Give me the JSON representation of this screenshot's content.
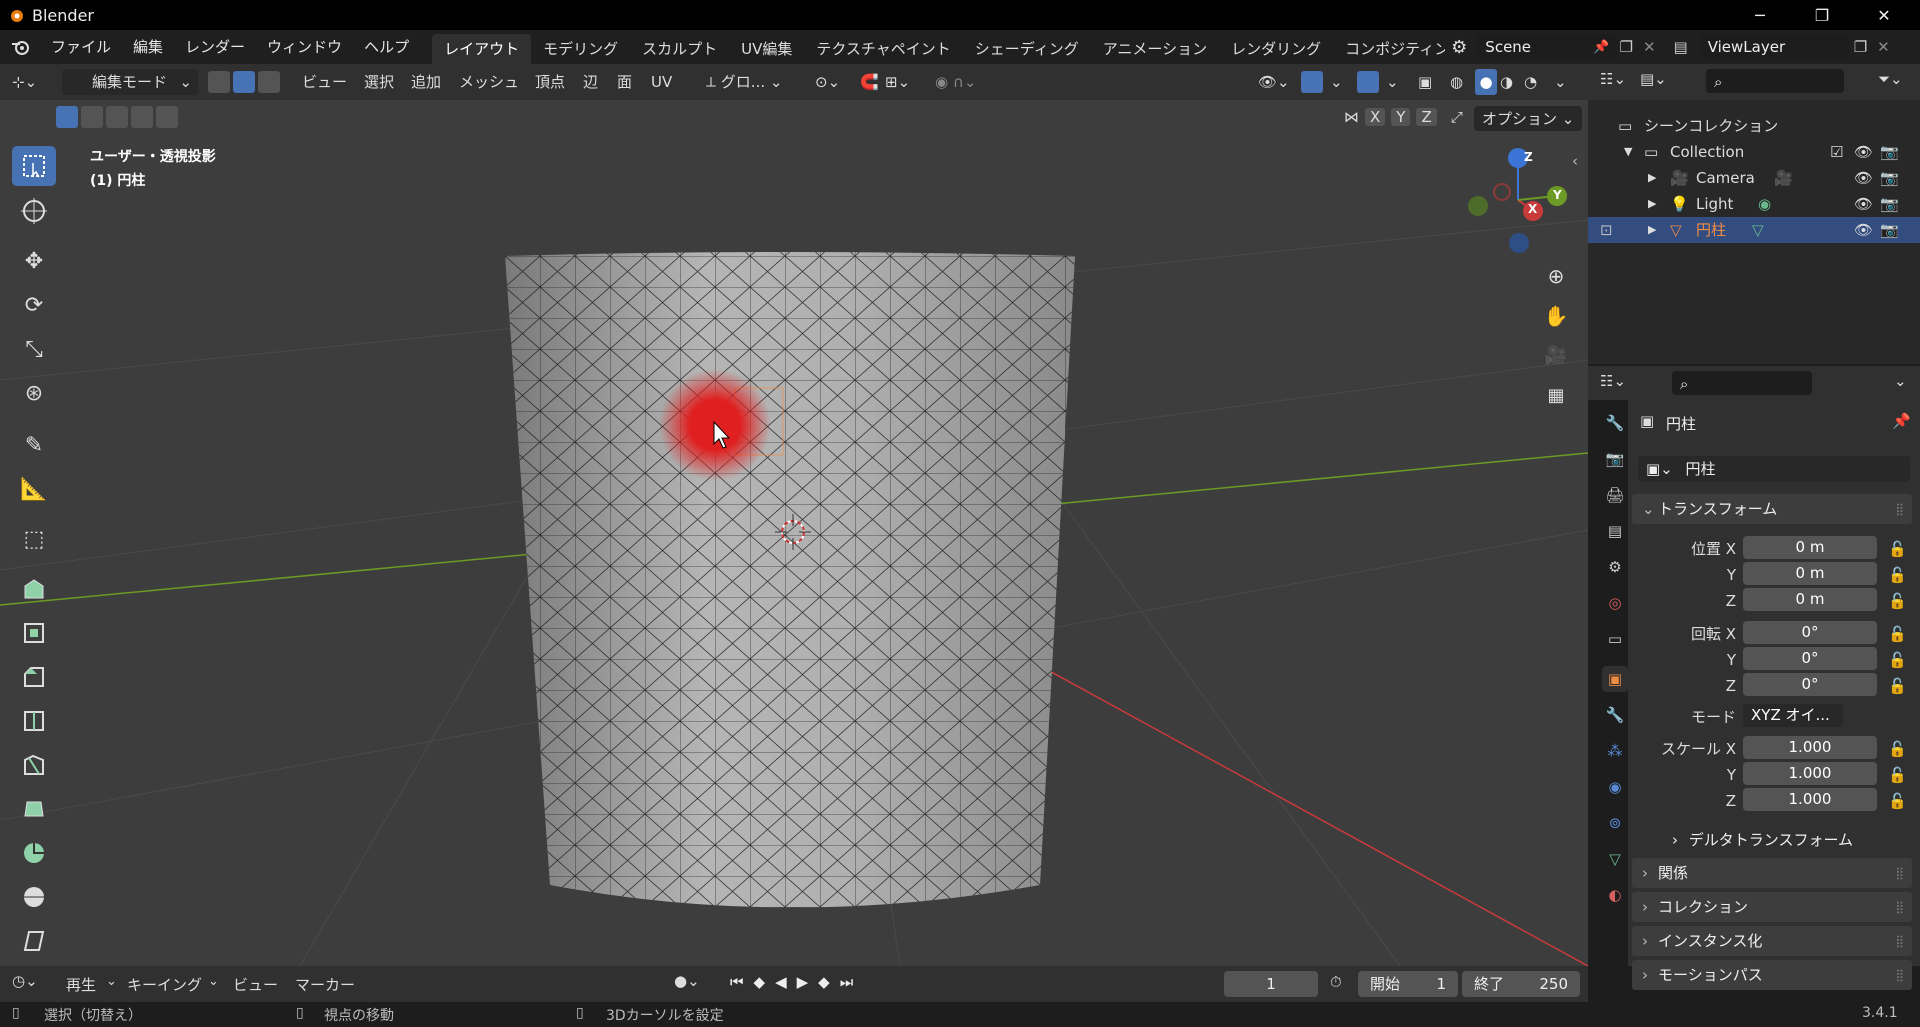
{
  "window": {
    "title": "Blender",
    "minimize": "─",
    "maximize": "❐",
    "close": "✕"
  },
  "menus": [
    "ファイル",
    "編集",
    "レンダー",
    "ウィンドウ",
    "ヘルプ"
  ],
  "workspaces": [
    "レイアウト",
    "モデリング",
    "スカルプト",
    "UV編集",
    "テクスチャペイント",
    "シェーディング",
    "アニメーション",
    "レンダリング",
    "コンポジティン:"
  ],
  "scene": {
    "name": "Scene",
    "view_layer": "ViewLayer"
  },
  "viewport_header": {
    "mode": "編集モード",
    "menus": [
      "ビュー",
      "選択",
      "追加",
      "メッシュ",
      "頂点",
      "辺",
      "面",
      "UV"
    ],
    "orientation": "グロ...",
    "axes": [
      "X",
      "Y",
      "Z"
    ],
    "options": "オプション"
  },
  "viewport": {
    "view_name": "ユーザー・透視投影",
    "object_label": "(1) 円柱",
    "gizmo": {
      "x": "X",
      "y": "Y",
      "z": "Z"
    }
  },
  "outliner": {
    "root": "シーンコレクション",
    "collection": "Collection",
    "items": [
      {
        "name": "Camera",
        "selected": false
      },
      {
        "name": "Light",
        "selected": false
      },
      {
        "name": "円柱",
        "selected": true
      }
    ]
  },
  "properties": {
    "object_name": "円柱",
    "data_name": "円柱",
    "transform_header": "トランスフォーム",
    "location_label": "位置 X",
    "rotation_label": "回転 X",
    "scale_label": "スケール X",
    "y_label": "Y",
    "z_label": "Z",
    "location": [
      "0 m",
      "0 m",
      "0 m"
    ],
    "rotation": [
      "0°",
      "0°",
      "0°"
    ],
    "mode_label": "モード",
    "mode_value": "XYZ オイ...",
    "scale": [
      "1.000",
      "1.000",
      "1.000"
    ],
    "delta": "デルタトランスフォーム",
    "sections": [
      "関係",
      "コレクション",
      "インスタンス化",
      "モーションパス"
    ]
  },
  "timeline": {
    "menus": [
      "再生",
      "キーイング",
      "ビュー",
      "マーカー"
    ],
    "current_frame": "1",
    "start_label": "開始",
    "start": "1",
    "end_label": "終了",
    "end": "250"
  },
  "status": {
    "select": "選択（切替え）",
    "move_view": "視点の移動",
    "cursor": "3Dカーソルを設定",
    "version": "3.4.1"
  },
  "colors": {
    "accent": "#4772b3",
    "active_object": "#ee8c42",
    "x_axis": "#c93a3a",
    "y_axis": "#6c9a25",
    "z_axis": "#3b74d4"
  }
}
